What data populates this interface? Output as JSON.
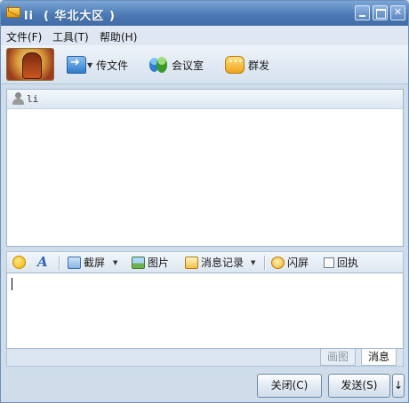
{
  "window": {
    "title": "li  ( 华北大区 )"
  },
  "menubar": {
    "items": [
      "文件(F)",
      "工具(T)",
      "帮助(H)"
    ]
  },
  "toolbar": {
    "send_file": "传文件",
    "meeting": "会议室",
    "group_send": "群发"
  },
  "conversation": {
    "contact": "li"
  },
  "input_toolbar": {
    "screenshot": "截屏",
    "image": "图片",
    "history": "消息记录",
    "flash": "闪屏",
    "receipt": "回执"
  },
  "tabs": {
    "draw": "画图",
    "message": "消息"
  },
  "buttons": {
    "close": "关闭(C)",
    "send": "发送(S)",
    "more": "↓"
  }
}
